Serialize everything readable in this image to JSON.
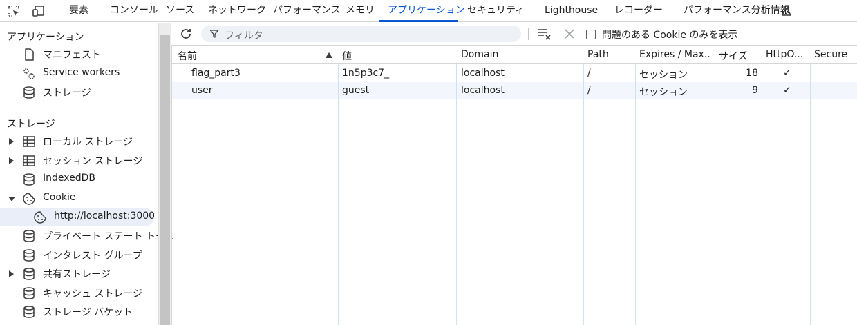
{
  "tabs": [
    "要素",
    "コンソール",
    "ソース",
    "ネットワーク",
    "パフォーマンス",
    "メモリ",
    "アプリケーション",
    "セキュリティ",
    "Lighthouse",
    "レコーダー",
    "パフォーマンス分析情報"
  ],
  "active_tab": "アプリケーション",
  "sidebar": {
    "app_heading": "アプリケーション",
    "app_items": [
      {
        "label": "マニフェスト",
        "icon": "file-icon"
      },
      {
        "label": "Service workers",
        "icon": "gears-icon"
      },
      {
        "label": "ストレージ",
        "icon": "database-icon"
      }
    ],
    "storage_heading": "ストレージ",
    "storage_items": [
      {
        "label": "ローカル ストレージ",
        "icon": "table-icon",
        "arrow": "right"
      },
      {
        "label": "セッション ストレージ",
        "icon": "table-icon",
        "arrow": "right"
      },
      {
        "label": "IndexedDB",
        "icon": "database-icon",
        "arrow": ""
      },
      {
        "label": "Cookie",
        "icon": "cookie-icon",
        "arrow": "down"
      },
      {
        "label": "http://localhost:3000",
        "icon": "cookie-icon",
        "arrow": "",
        "child": true,
        "selected": true
      },
      {
        "label": "プライベート ステート トー...",
        "icon": "database-icon",
        "arrow": ""
      },
      {
        "label": "インタレスト グループ",
        "icon": "database-icon",
        "arrow": ""
      },
      {
        "label": "共有ストレージ",
        "icon": "database-icon",
        "arrow": "right"
      },
      {
        "label": "キャッシュ ストレージ",
        "icon": "database-icon",
        "arrow": ""
      },
      {
        "label": "ストレージ バケット",
        "icon": "database-icon",
        "arrow": ""
      }
    ]
  },
  "toolbar": {
    "filter_placeholder": "フィルタ",
    "only_issues_label": "問題のある Cookie のみを表示",
    "only_issues_checked": false
  },
  "table": {
    "columns": [
      "名前",
      "値",
      "Domain",
      "Path",
      "Expires / Max...",
      "サイズ",
      "HttpO...",
      "Secure"
    ],
    "sort_column": "名前",
    "rows": [
      {
        "name": "flag_part3",
        "value": "1n5p3c7_",
        "domain": "localhost",
        "path": "/",
        "expires": "セッション",
        "size": "18",
        "httponly": "✓",
        "secure": ""
      },
      {
        "name": "user",
        "value": "guest",
        "domain": "localhost",
        "path": "/",
        "expires": "セッション",
        "size": "9",
        "httponly": "✓",
        "secure": ""
      }
    ]
  },
  "colors": {
    "accent": "#0b57d0",
    "row_alt": "#f3f6fc",
    "column_line": "#cfe1f5"
  }
}
